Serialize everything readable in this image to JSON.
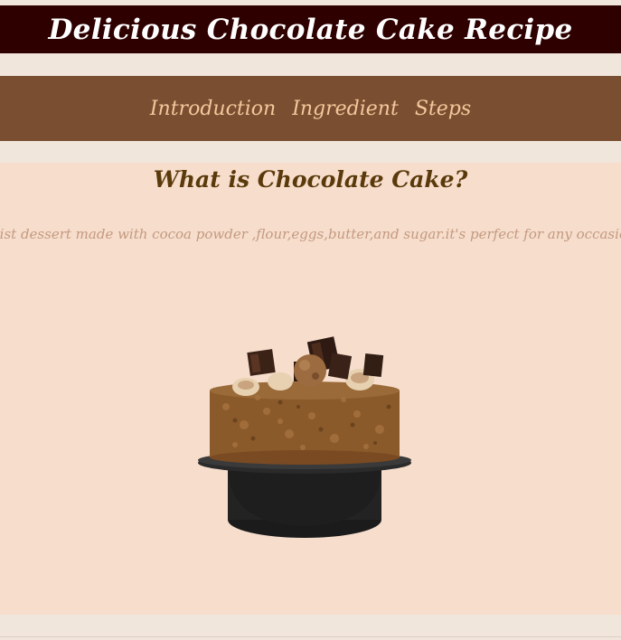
{
  "header": {
    "title": "Delicious Chocolate Cake Recipe"
  },
  "nav": {
    "items": [
      {
        "label": "Introduction"
      },
      {
        "label": "Ingredient"
      },
      {
        "label": "Steps"
      }
    ]
  },
  "intro": {
    "heading": "What is Chocolate Cake?",
    "text": "uist dessert made with cocoa powder ,flour,eggs,butter,and sugar.it's perfect for any occasion,ea"
  },
  "colors": {
    "header_bg": "#2e0000",
    "nav_bg": "#7a4e30",
    "nav_text": "#f2c89c",
    "section_bg": "#f6ddcc",
    "heading": "#5a3a0a"
  },
  "image": {
    "name": "chocolate-cake-image"
  }
}
